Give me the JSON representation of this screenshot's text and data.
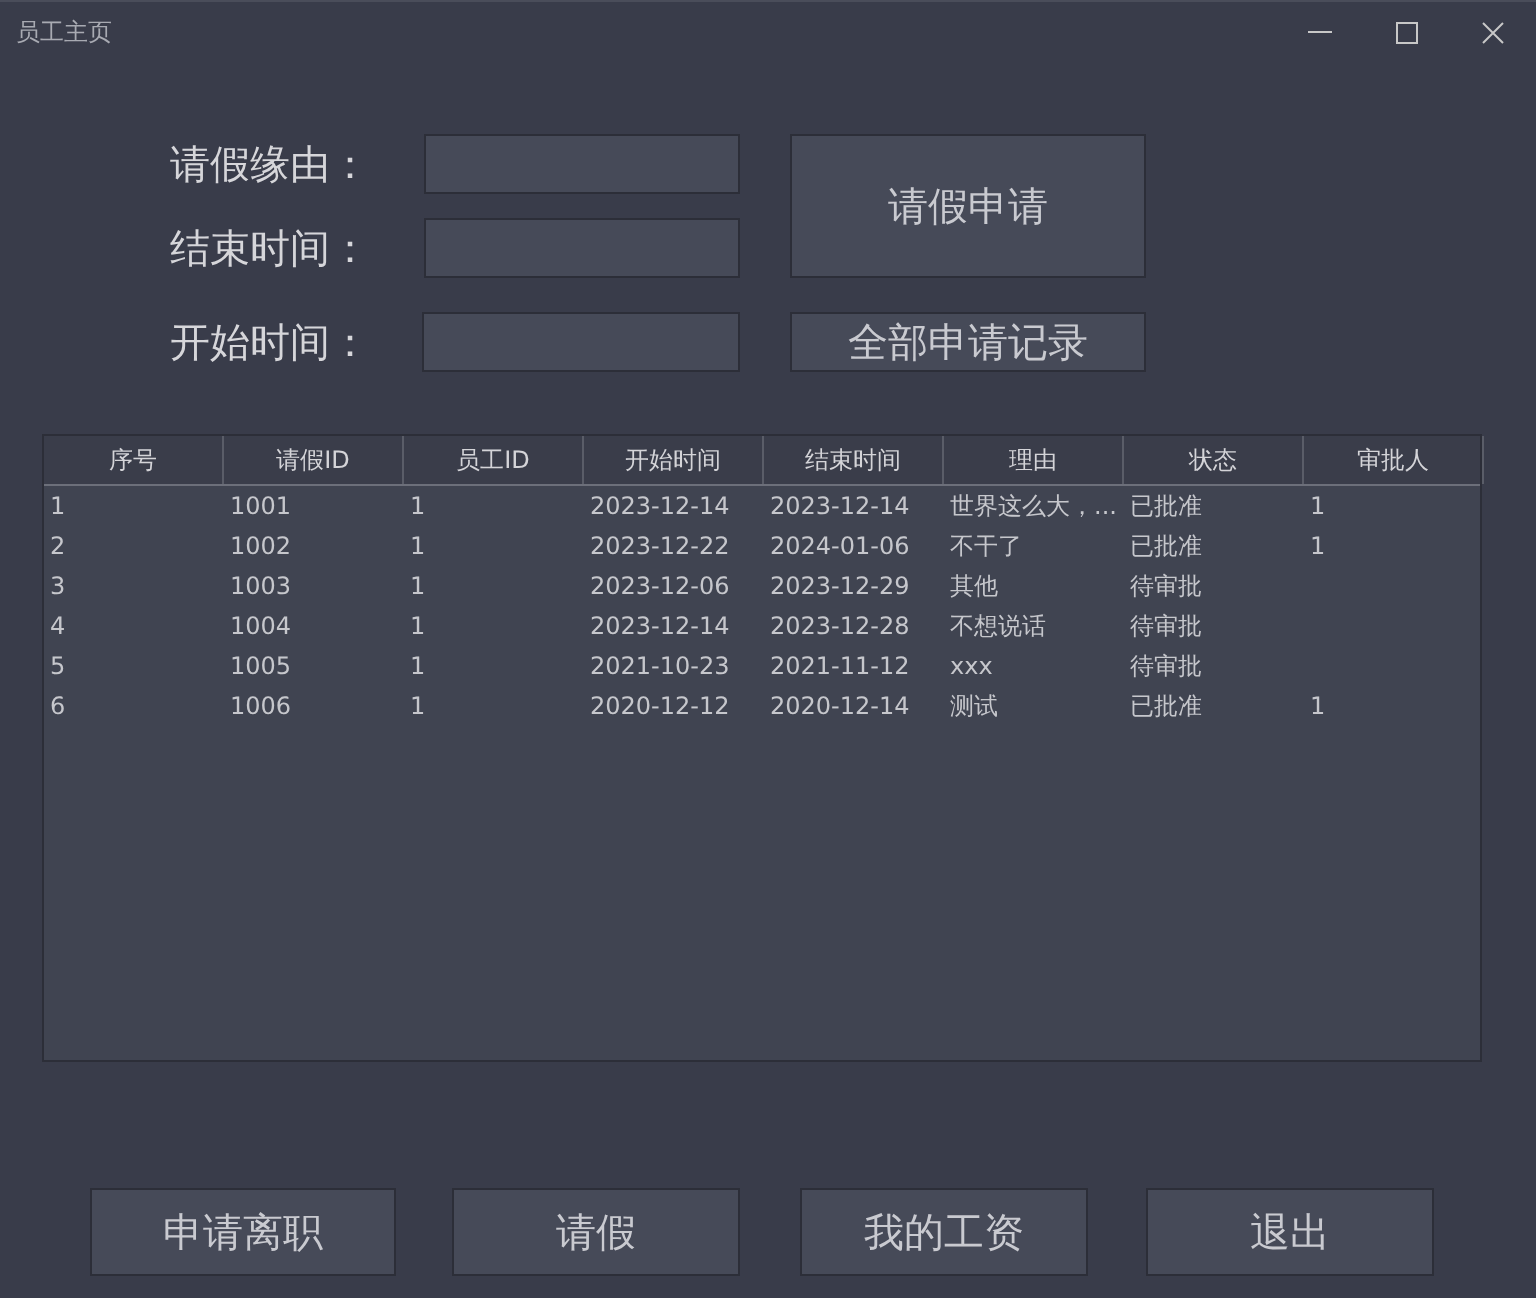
{
  "window": {
    "title": "员工主页"
  },
  "form": {
    "fields": [
      {
        "label": "请假缘由："
      },
      {
        "label": "结束时间："
      },
      {
        "label": "开始时间："
      }
    ],
    "buttons": [
      "请假申请",
      "全部申请记录"
    ]
  },
  "table": {
    "columns": [
      "序号",
      "请假ID",
      "员工ID",
      "开始时间",
      "结束时间",
      "理由",
      "状态",
      "审批人"
    ],
    "rows": [
      [
        "1",
        "1001",
        "1",
        "2023-12-14",
        "2023-12-14",
        "世界这么大，...",
        "已批准",
        "1"
      ],
      [
        "2",
        "1002",
        "1",
        "2023-12-22",
        "2024-01-06",
        "不干了",
        "已批准",
        "1"
      ],
      [
        "3",
        "1003",
        "1",
        "2023-12-06",
        "2023-12-29",
        "其他",
        "待审批",
        ""
      ],
      [
        "4",
        "1004",
        "1",
        "2023-12-14",
        "2023-12-28",
        "不想说话",
        "待审批",
        ""
      ],
      [
        "5",
        "1005",
        "1",
        "2021-10-23",
        "2021-11-12",
        "xxx",
        "待审批",
        ""
      ],
      [
        "6",
        "1006",
        "1",
        "2020-12-12",
        "2020-12-14",
        "测试",
        "已批准",
        "1"
      ]
    ]
  },
  "footer_buttons": [
    "申请离职",
    "请假",
    "我的工资",
    "退出"
  ]
}
